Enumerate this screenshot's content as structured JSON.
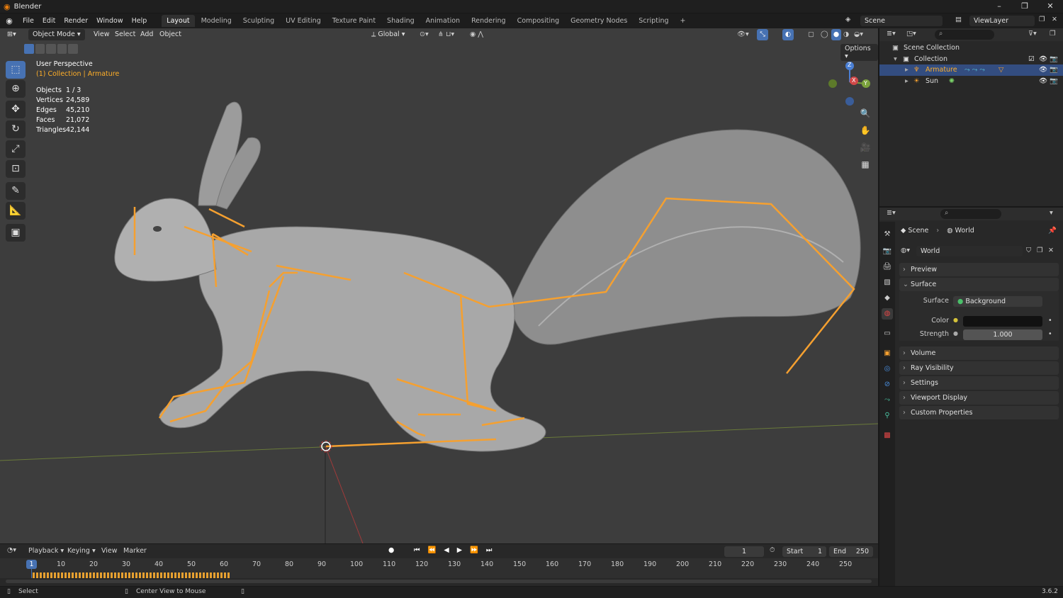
{
  "window": {
    "title": "Blender",
    "minimize": "–",
    "maximize": "❐",
    "close": "✕"
  },
  "menu": {
    "items": [
      "File",
      "Edit",
      "Render",
      "Window",
      "Help"
    ]
  },
  "workspaces": {
    "tabs": [
      "Layout",
      "Modeling",
      "Sculpting",
      "UV Editing",
      "Texture Paint",
      "Shading",
      "Animation",
      "Rendering",
      "Compositing",
      "Geometry Nodes",
      "Scripting"
    ],
    "active": "Layout",
    "add": "+"
  },
  "scene_selector": {
    "scene": "Scene",
    "view_layer": "ViewLayer"
  },
  "viewport": {
    "mode": "Object Mode",
    "menus": [
      "View",
      "Select",
      "Add",
      "Object"
    ],
    "transform_orientation": "Global",
    "options_label": "Options",
    "perspective": "User Perspective",
    "collection_info": "(1) Collection | Armature",
    "stats": [
      {
        "label": "Objects",
        "value": "1 / 3"
      },
      {
        "label": "Vertices",
        "value": "24,589"
      },
      {
        "label": "Edges",
        "value": "45,210"
      },
      {
        "label": "Faces",
        "value": "21,072"
      },
      {
        "label": "Triangles",
        "value": "42,144"
      }
    ],
    "gizmo": {
      "z": "Z",
      "x": "X",
      "y": "Y"
    }
  },
  "outliner": {
    "root": "Scene Collection",
    "collection": "Collection",
    "items": [
      "Armature",
      "Sun"
    ]
  },
  "properties": {
    "breadcrumb": [
      "Scene",
      "World"
    ],
    "world_name": "World",
    "panels": {
      "preview": "Preview",
      "surface": "Surface",
      "volume": "Volume",
      "ray_visibility": "Ray Visibility",
      "settings": "Settings",
      "viewport_display": "Viewport Display",
      "custom_properties": "Custom Properties"
    },
    "surface_label": "Surface",
    "surface_value": "Background",
    "color_label": "Color",
    "strength_label": "Strength",
    "strength_value": "1.000"
  },
  "timeline": {
    "menus": [
      "Playback",
      "Keying",
      "View",
      "Marker"
    ],
    "current_frame": "1",
    "start_label": "Start",
    "start_value": "1",
    "end_label": "End",
    "end_value": "250",
    "ruler": [
      "1",
      "10",
      "20",
      "30",
      "40",
      "50",
      "60",
      "70",
      "80",
      "90",
      "100",
      "110",
      "120",
      "130",
      "140",
      "150",
      "160",
      "170",
      "180",
      "190",
      "200",
      "210",
      "220",
      "230",
      "240",
      "250"
    ]
  },
  "statusbar": {
    "select": "Select",
    "center_view": "Center View to Mouse",
    "version": "3.6.2"
  },
  "colors": {
    "accent": "#4772b3",
    "bone": "#f5a030",
    "selected_text": "#ffaf29"
  }
}
